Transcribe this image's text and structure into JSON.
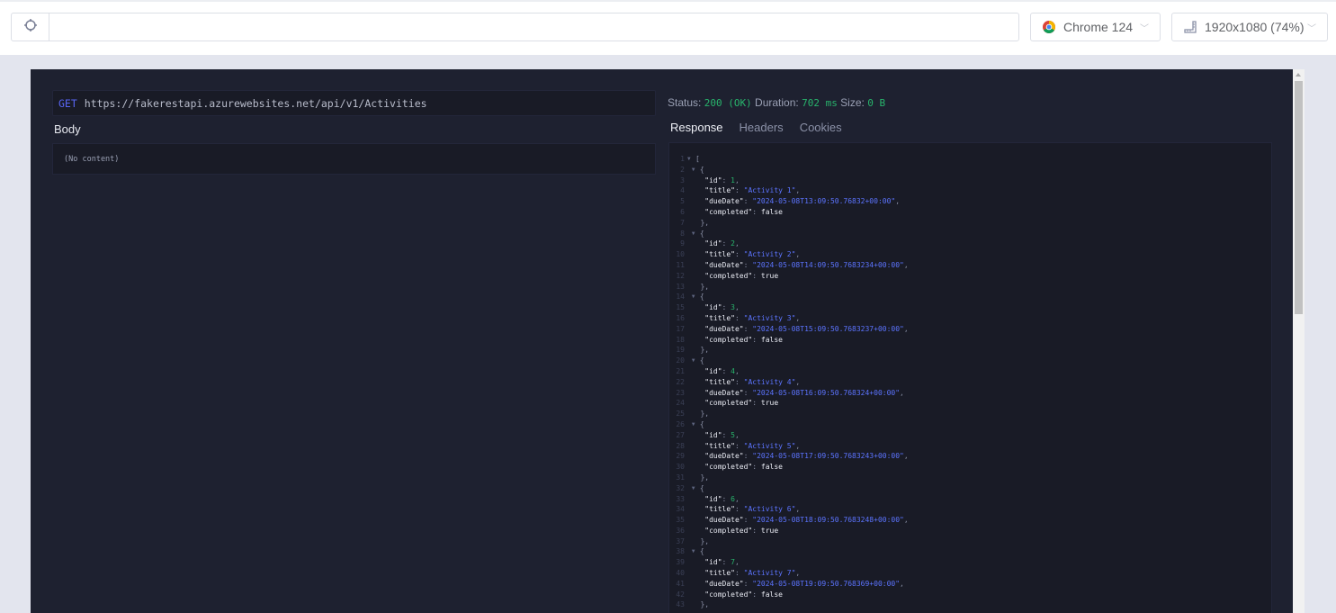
{
  "toolbar": {
    "url_value": "",
    "browser": {
      "label": "Chrome 124",
      "icon": "chrome-icon"
    },
    "resolution": {
      "label": "1920x1080 (74%)",
      "icon": "ruler-icon"
    }
  },
  "request": {
    "method": "GET",
    "url": "https://fakerestapi.azurewebsites.net/api/v1/Activities",
    "body_label": "Body",
    "body_content": "(No content)"
  },
  "response": {
    "status_label": "Status:",
    "status_value": "200 (OK)",
    "duration_label": "Duration:",
    "duration_value": "702 ms",
    "size_label": "Size:",
    "size_value": "0 B",
    "tabs": [
      {
        "label": "Response",
        "active": true
      },
      {
        "label": "Headers",
        "active": false
      },
      {
        "label": "Cookies",
        "active": false
      }
    ],
    "items": [
      {
        "id": 1,
        "title": "Activity 1",
        "dueDate": "2024-05-08T13:09:50.76832+00:00",
        "completed": "false"
      },
      {
        "id": 2,
        "title": "Activity 2",
        "dueDate": "2024-05-08T14:09:50.7683234+00:00",
        "completed": "true"
      },
      {
        "id": 3,
        "title": "Activity 3",
        "dueDate": "2024-05-08T15:09:50.7683237+00:00",
        "completed": "false"
      },
      {
        "id": 4,
        "title": "Activity 4",
        "dueDate": "2024-05-08T16:09:50.768324+00:00",
        "completed": "true"
      },
      {
        "id": 5,
        "title": "Activity 5",
        "dueDate": "2024-05-08T17:09:50.7683243+00:00",
        "completed": "false"
      },
      {
        "id": 6,
        "title": "Activity 6",
        "dueDate": "2024-05-08T18:09:50.7683248+00:00",
        "completed": "true"
      },
      {
        "id": 7,
        "title": "Activity 7",
        "dueDate": "2024-05-08T19:09:50.768369+00:00",
        "completed": "false"
      }
    ]
  }
}
